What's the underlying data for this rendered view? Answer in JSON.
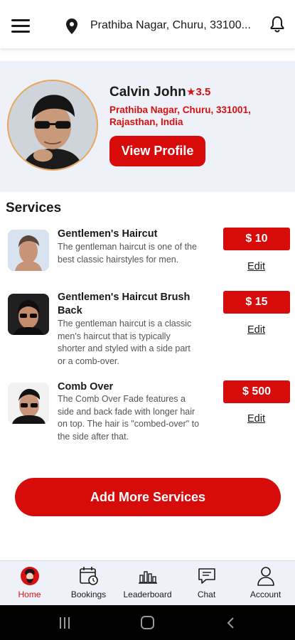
{
  "header": {
    "location": "Prathiba Nagar, Churu, 33100...",
    "menu_icon": "hamburger-menu-icon",
    "location_icon": "map-pin-icon",
    "notification_icon": "bell-icon"
  },
  "profile": {
    "name": "Calvin John",
    "rating": "★3.5",
    "address": "Prathiba Nagar, Churu, 331001, Rajasthan, India",
    "view_profile_label": "View Profile"
  },
  "services": {
    "title": "Services",
    "items": [
      {
        "name": "Gentlemen's Haircut",
        "description": "The gentleman haircut is one of the best classic hairstyles for men.",
        "price": "$ 10",
        "edit_label": "Edit"
      },
      {
        "name": "Gentlemen's Haircut Brush Back",
        "description": "The gentleman haircut is a classic men's haircut that is typically shorter and styled with a side part or a comb-over.",
        "price": "$ 15",
        "edit_label": "Edit"
      },
      {
        "name": "Comb Over",
        "description": "The Comb Over Fade features a side and back fade with longer hair on top. The hair is \"combed-over\" to the side after that.",
        "price": "$ 500",
        "edit_label": "Edit"
      }
    ],
    "add_more_label": "Add More Services"
  },
  "bottom_nav": {
    "items": [
      {
        "label": "Home",
        "icon": "barber-home-icon",
        "active": true
      },
      {
        "label": "Bookings",
        "icon": "calendar-clock-icon",
        "active": false
      },
      {
        "label": "Leaderboard",
        "icon": "bar-chart-icon",
        "active": false
      },
      {
        "label": "Chat",
        "icon": "chat-bubble-icon",
        "active": false
      },
      {
        "label": "Account",
        "icon": "user-icon",
        "active": false
      }
    ]
  },
  "colors": {
    "accent": "#d80b0b",
    "card_background": "#eef1f7",
    "avatar_border": "#e9a45a"
  }
}
